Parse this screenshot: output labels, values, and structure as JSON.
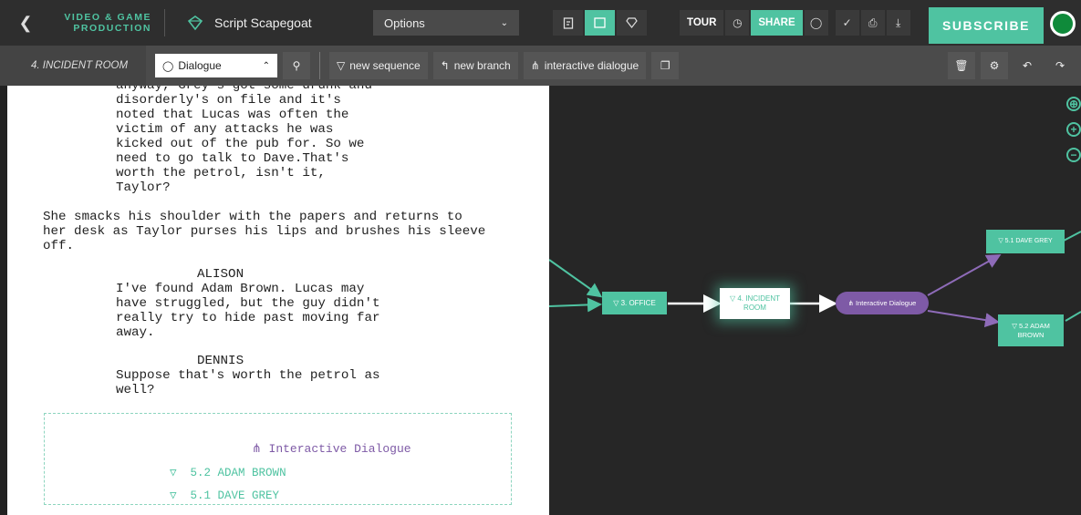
{
  "topbar": {
    "brand_line1": "VIDEO & GAME",
    "brand_line2": "PRODUCTION",
    "project_title": "Script Scapegoat",
    "options_label": "Options",
    "tour_label": "TOUR",
    "share_label": "SHARE",
    "subscribe_label": "SUBSCRIBE"
  },
  "subbar": {
    "scene_label": "4. INCIDENT ROOM",
    "dialogue_select": "Dialogue",
    "new_sequence": "new sequence",
    "new_branch": "new branch",
    "interactive_dialogue": "interactive dialogue"
  },
  "script": {
    "lines": [
      "anyway, Grey's got some drunk and",
      "disorderly's on file and it's",
      "noted that Lucas was often the",
      "victim of any attacks he was",
      "kicked out of the pub for. So we",
      "need to go talk to Dave.That's",
      "worth the petrol, isn't it,",
      "Taylor?"
    ],
    "action": [
      "She smacks his shoulder with the papers and returns to",
      "her desk as Taylor purses his lips and brushes his sleeve",
      "off."
    ],
    "char1": "ALISON",
    "dialogue1": [
      "I've found Adam Brown. Lucas may",
      "have struggled, but the guy didn't",
      "really try to hide past moving far",
      "away."
    ],
    "char2": "DENNIS",
    "dialogue2": [
      "Suppose that's worth the petrol as",
      "well?"
    ],
    "interactive_title": "Interactive Dialogue",
    "option1": "5.2 ADAM BROWN",
    "option2": "5.1 DAVE GREY"
  },
  "graph": {
    "node_office": "3. OFFICE",
    "node_incident_1": "4. INCIDENT",
    "node_incident_2": "ROOM",
    "node_interactive": "Interactive Dialogue",
    "node_dave": "5.1 DAVE GREY",
    "node_adam_1": "5.2 ADAM",
    "node_adam_2": "BROWN"
  },
  "colors": {
    "accent": "#4fc3a1",
    "interactive": "#7e5aa6"
  }
}
